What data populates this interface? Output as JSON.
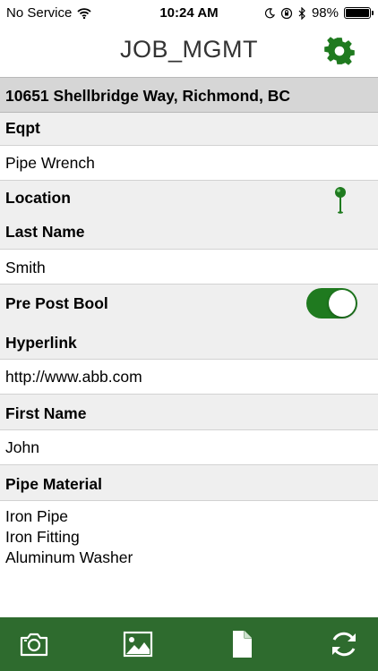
{
  "status_bar": {
    "carrier": "No Service",
    "time": "10:24 AM",
    "battery": "98%"
  },
  "header": {
    "title": "JOB_MGMT",
    "settings_icon": "gear-icon"
  },
  "address": "10651 Shellbridge Way, Richmond, BC",
  "fields": {
    "eqpt": {
      "label": "Eqpt",
      "value": "Pipe Wrench"
    },
    "location": {
      "label": "Location",
      "icon": "map-pin-icon"
    },
    "last_name": {
      "label": "Last Name",
      "value": "Smith"
    },
    "pre_post_bool": {
      "label": "Pre Post Bool",
      "on": true
    },
    "hyperlink": {
      "label": "Hyperlink",
      "value": "http://www.abb.com"
    },
    "first_name": {
      "label": "First Name",
      "value": "John"
    },
    "pipe_material": {
      "label": "Pipe Material",
      "values": [
        "Iron Pipe",
        "Iron Fitting",
        "Aluminum Washer"
      ]
    }
  },
  "toolbar": {
    "items": [
      "camera-icon",
      "image-icon",
      "document-icon",
      "sync-icon"
    ]
  },
  "colors": {
    "accent": "#1f7a1f",
    "toolbar": "#2e6b2e",
    "label_bg": "#efefef",
    "address_bg": "#d6d6d6"
  }
}
